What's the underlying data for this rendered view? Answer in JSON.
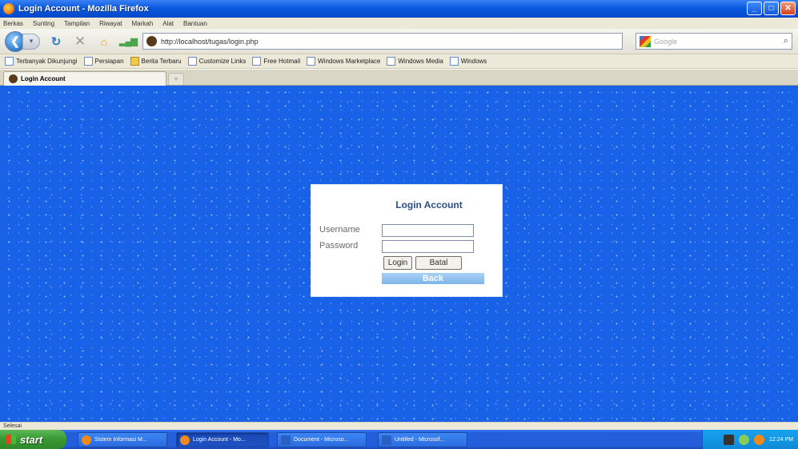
{
  "window": {
    "title": "Login Account - Mozilla Firefox"
  },
  "menu": [
    "Berkas",
    "Sunting",
    "Tampilan",
    "Riwayat",
    "Markah",
    "Alat",
    "Bantuan"
  ],
  "nav": {
    "url": "http://localhost/tugas/login.php",
    "search_placeholder": "Google"
  },
  "bookmarks": [
    {
      "label": "Terbanyak Dikunjungi",
      "icon": "page-icon"
    },
    {
      "label": "Persiapan",
      "icon": "page-icon"
    },
    {
      "label": "Berita Terbaru",
      "icon": "folder-icon"
    },
    {
      "label": "Customize Links",
      "icon": "page-icon"
    },
    {
      "label": "Free Hotmail",
      "icon": "page-icon"
    },
    {
      "label": "Windows Marketplace",
      "icon": "page-icon"
    },
    {
      "label": "Windows Media",
      "icon": "page-icon"
    },
    {
      "label": "Windows",
      "icon": "page-icon"
    }
  ],
  "tab": {
    "label": "Login Account"
  },
  "login": {
    "title": "Login Account",
    "username_label": "Username",
    "password_label": "Password",
    "username_value": "",
    "password_value": "",
    "login_button": "Login",
    "batal_button": "Batal",
    "back_label": "Back"
  },
  "status": {
    "text": "Selesai"
  },
  "taskbar": {
    "start": "start",
    "tasks": [
      "Sistem Informasi M...",
      "Login Account - Mo...",
      "Document - Microso...",
      "Untitled - Microsof..."
    ],
    "clock": "12:24 PM"
  },
  "colors": {
    "page_background": "#1862e8",
    "login_title": "#2a4f86",
    "back_button": "#7fb5ea"
  }
}
